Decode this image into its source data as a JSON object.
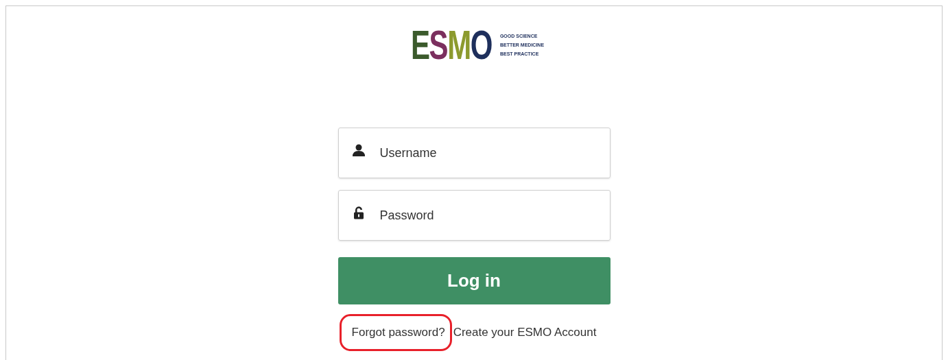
{
  "logo": {
    "letters": [
      {
        "text": "E",
        "color": "#3b5a2c"
      },
      {
        "text": "S",
        "color": "#7b2f5e"
      },
      {
        "text": "M",
        "color": "#8c9a2e"
      },
      {
        "text": "O",
        "color": "#1e2f5c"
      }
    ],
    "tagline": [
      "GOOD SCIENCE",
      "BETTER MEDICINE",
      "BEST PRACTICE"
    ]
  },
  "fields": [
    {
      "kind": "user",
      "placeholder": "Username"
    },
    {
      "kind": "lock",
      "placeholder": "Password"
    }
  ],
  "login_button": "Log in",
  "links": [
    {
      "text": "Forgot password?",
      "highlighted": true
    },
    {
      "text": "Create your ESMO Account",
      "highlighted": false
    }
  ]
}
